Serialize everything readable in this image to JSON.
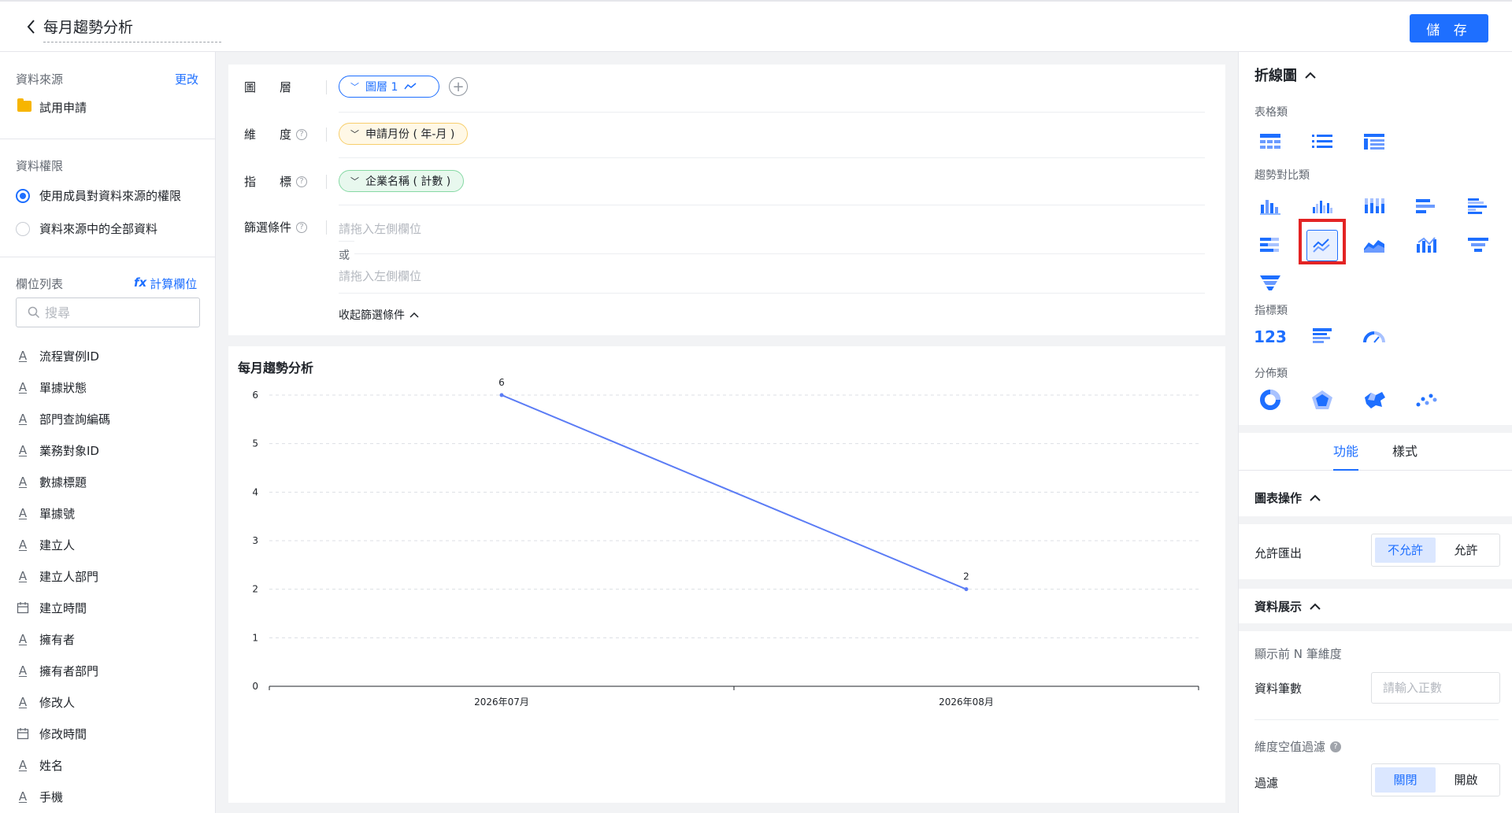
{
  "header": {
    "title": "每月趨勢分析",
    "save_label": "儲 存"
  },
  "left": {
    "source_label": "資料來源",
    "source_change": "更改",
    "source_name": "試用申請",
    "permission_label": "資料權限",
    "permission_options": [
      "使用成員對資料來源的權限",
      "資料來源中的全部資料"
    ],
    "fields_label": "欄位列表",
    "calc_field": "計算欄位",
    "search_placeholder": "搜尋",
    "fields": [
      {
        "name": "流程實例ID",
        "type": "text"
      },
      {
        "name": "單據狀態",
        "type": "text"
      },
      {
        "name": "部門查詢編碼",
        "type": "text"
      },
      {
        "name": "業務對象ID",
        "type": "text"
      },
      {
        "name": "數據標題",
        "type": "text"
      },
      {
        "name": "單據號",
        "type": "text"
      },
      {
        "name": "建立人",
        "type": "text"
      },
      {
        "name": "建立人部門",
        "type": "text"
      },
      {
        "name": "建立時間",
        "type": "date"
      },
      {
        "name": "擁有者",
        "type": "text"
      },
      {
        "name": "擁有者部門",
        "type": "text"
      },
      {
        "name": "修改人",
        "type": "text"
      },
      {
        "name": "修改時間",
        "type": "date"
      },
      {
        "name": "姓名",
        "type": "text"
      },
      {
        "name": "手機",
        "type": "text"
      }
    ]
  },
  "config": {
    "layer_label": "圖　　層",
    "layer_pill": "圖層 1",
    "dimension_label": "維　　度",
    "dimension_pill": "申請月份 ( 年-月 )",
    "metric_label": "指　　標",
    "metric_pill": "企業名稱 ( 計數 )",
    "filter_label": "篩選條件",
    "filter_placeholder_1": "請拖入左側欄位",
    "or_text": "或",
    "filter_placeholder_2": "請拖入左側欄位",
    "collapse_label": "收起篩選條件"
  },
  "chart_data": {
    "type": "line",
    "title": "每月趨勢分析",
    "categories": [
      "2026年07月",
      "2026年08月"
    ],
    "values": [
      6,
      2
    ],
    "ylim": [
      0,
      6
    ],
    "yticks": [
      "0",
      "1",
      "2",
      "3",
      "4",
      "5",
      "6"
    ],
    "data_labels": [
      "6",
      "2"
    ],
    "grid": true,
    "line_color": "#5b7cf5"
  },
  "right": {
    "chart_type_title": "折線圖",
    "cat_table": "表格類",
    "cat_trend": "趨勢對比類",
    "cat_metric": "指標類",
    "cat_metric_icon_text": "123",
    "cat_dist": "分佈類",
    "tab_function": "功能",
    "tab_style": "樣式",
    "chart_ops_title": "圖表操作",
    "allow_export_label": "允許匯出",
    "export_off": "不允許",
    "export_on": "允許",
    "data_display_title": "資料展示",
    "top_n_label": "顯示前 N 筆維度",
    "data_count_label": "資料筆數",
    "data_count_placeholder": "請輸入正數",
    "null_filter_label": "維度空值過濾",
    "filter_label": "過濾",
    "filter_off": "關閉",
    "filter_on": "開啟"
  },
  "colors": {
    "accent": "#1e6fff",
    "highlight": "#e32424"
  }
}
